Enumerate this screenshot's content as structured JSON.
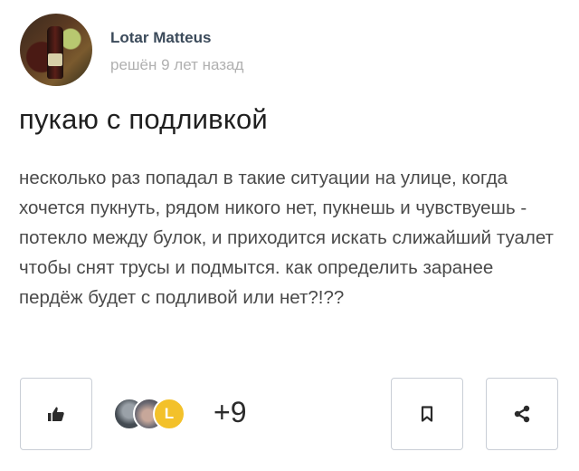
{
  "author": {
    "name": "Lotar Matteus",
    "meta": "решён 9 лет назад"
  },
  "post": {
    "title": "пукаю с подливкой",
    "body": "несколько раз попадал в такие ситуации на улице, когда хочется пукнуть, рядом никого нет, пукнешь и чувствуешь - потекло между булок, и приходится искать слижайший туалет чтобы снят трусы и подмытся. как определить заранее пердёж будет с подливой или нет?!??"
  },
  "actions": {
    "voters_badge": "L",
    "voters_more": "+9",
    "icons": [
      "thumbs-up-icon",
      "bookmark-icon",
      "share-icon"
    ]
  }
}
